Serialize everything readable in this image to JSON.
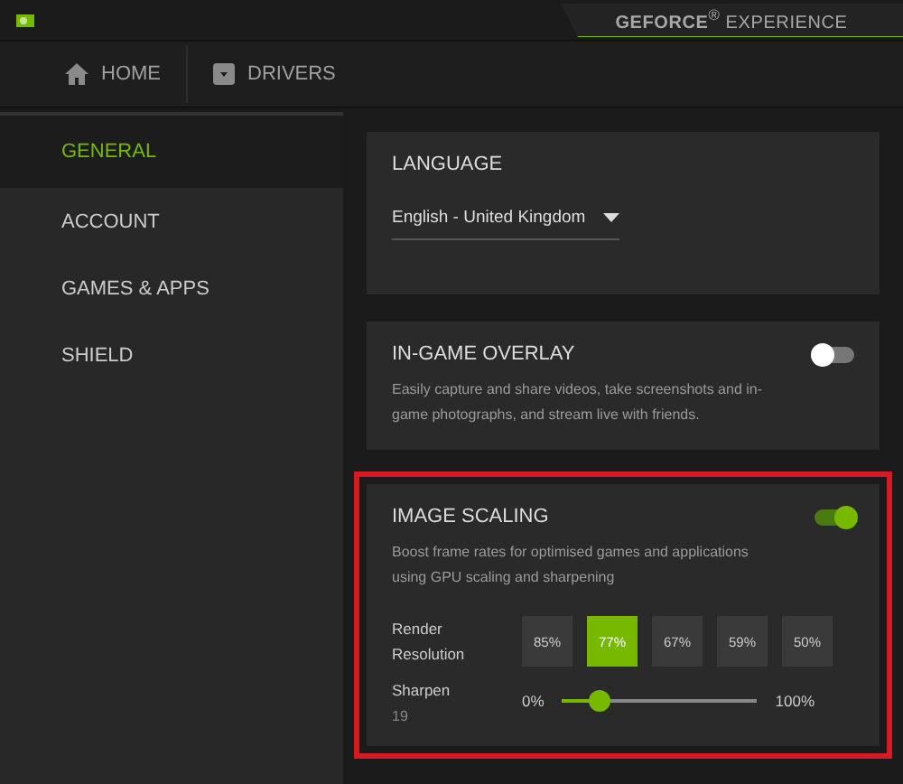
{
  "title_bar": {
    "brand": "**GEFORCE**$^{®}$ EXPERIENCE"
  },
  "nav": [
    {
      "label": "HOME",
      "selected": false
    },
    {
      "label": "DRIVERS",
      "selected": false
    }
  ],
  "sidebar": {
    "items": [
      {
        "label": "GENERAL",
        "selected": true
      },
      {
        "label": "ACCOUNT",
        "selected": false
      },
      {
        "label": "GAMES & APPS",
        "selected": false
      },
      {
        "label": "SHIELD",
        "selected": false
      }
    ]
  },
  "cards": [
    {
      "kind": "language",
      "title": "LANGUAGE",
      "value": "English - United Kingdom",
      "highlighted": false
    },
    {
      "kind": "overlay",
      "title": "IN-GAME OVERLAY",
      "on": false,
      "description": "Easily capture and share videos, take screenshots and in-game photographs, and stream live with friends.",
      "highlighted": false
    },
    {
      "kind": "scaling",
      "title": "IMAGE SCALING",
      "on": true,
      "description": "Boost frame rates for optimised games and applications using GPU scaling and sharpening",
      "highlighted": true,
      "resolution_label": "Render Resolution",
      "resolutions": [
        {
          "label": "85%",
          "selected": false
        },
        {
          "label": "77%",
          "selected": true
        },
        {
          "label": "67%",
          "selected": false
        },
        {
          "label": "59%",
          "selected": false
        },
        {
          "label": "50%",
          "selected": false
        }
      ],
      "sharpen": {
        "label": "Sharpen",
        "value": "19",
        "min": "0%",
        "max": "100%",
        "level": 0.19
      }
    }
  ]
}
